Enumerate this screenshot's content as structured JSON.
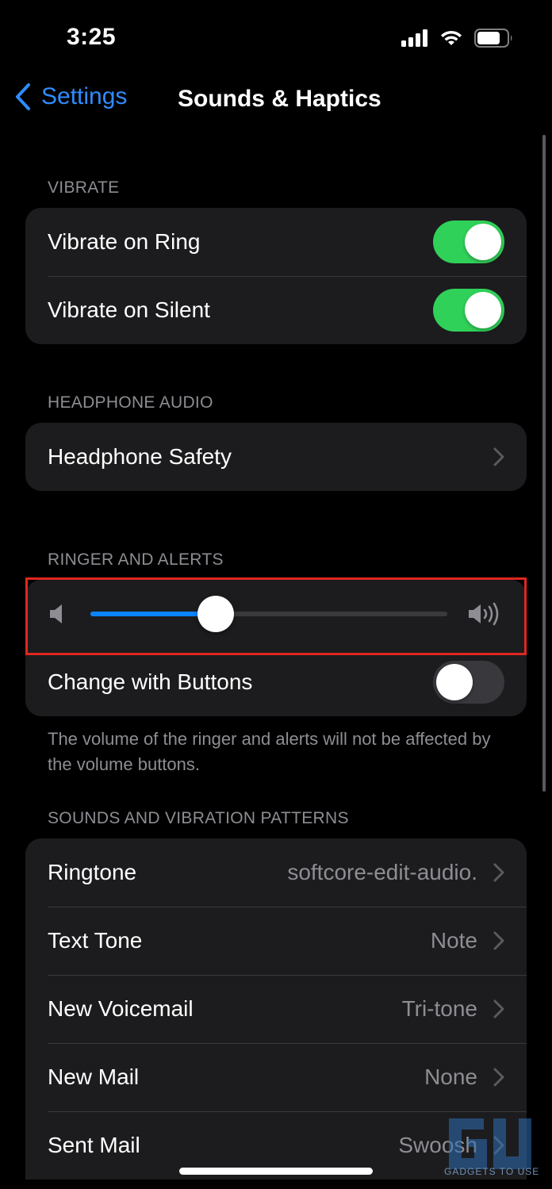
{
  "status_bar": {
    "time": "3:25"
  },
  "nav": {
    "back_label": "Settings",
    "title": "Sounds & Haptics"
  },
  "vibrate": {
    "header": "VIBRATE",
    "rows": [
      {
        "label": "Vibrate on Ring",
        "toggle": "on"
      },
      {
        "label": "Vibrate on Silent",
        "toggle": "on"
      }
    ]
  },
  "headphone": {
    "header": "HEADPHONE AUDIO",
    "rows": [
      {
        "label": "Headphone Safety"
      }
    ]
  },
  "ringer": {
    "header": "RINGER AND ALERTS",
    "volume_level": 0.35,
    "change_with_buttons": {
      "label": "Change with Buttons",
      "toggle": "off"
    },
    "footnote": "The volume of the ringer and alerts will not be affected by the volume buttons."
  },
  "sounds": {
    "header": "SOUNDS AND VIBRATION PATTERNS",
    "rows": [
      {
        "label": "Ringtone",
        "value": "softcore-edit-audio."
      },
      {
        "label": "Text Tone",
        "value": "Note"
      },
      {
        "label": "New Voicemail",
        "value": "Tri-tone"
      },
      {
        "label": "New Mail",
        "value": "None"
      },
      {
        "label": "Sent Mail",
        "value": "Swoosh"
      }
    ]
  },
  "watermark": {
    "text": "GADGETS TO USE"
  },
  "colors": {
    "accent": "#0a84ff",
    "toggle_on": "#30d158",
    "highlight": "#e0271f",
    "background": "#000000",
    "cell": "#1c1c1e"
  },
  "icons": [
    "back-chevron-icon",
    "signal-icon",
    "wifi-icon",
    "battery-icon",
    "speaker-low-icon",
    "speaker-high-icon",
    "chevron-right-icon"
  ]
}
